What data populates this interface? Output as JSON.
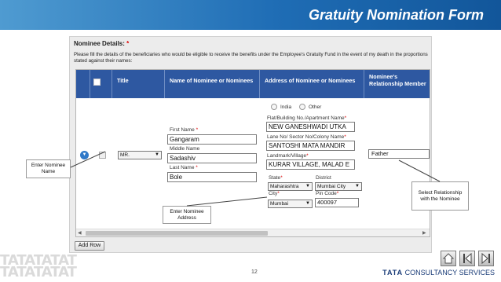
{
  "header": {
    "title": "Gratuity Nomination Form"
  },
  "form": {
    "section_title": "Nominee Details:",
    "required_mark": "*",
    "description": "Please fill the details of the beneficiaries who would be eligible to receive the benefits under the Employee's Gratuity Fund in the event of my death in the proportions stated against their names:"
  },
  "grid": {
    "columns": [
      "Title",
      "Name of Nominee or Nominees",
      "Address of Nominee or Nominees",
      "Nominee's Relationship Member"
    ],
    "row": {
      "title_value": "MR.",
      "first_name_label": "First Name",
      "first_name": "Gangaram",
      "middle_name_label": "Middle Name",
      "middle_name": "Sadashiv",
      "last_name_label": "Last Name",
      "last_name": "Bole",
      "address_options": [
        "India",
        "Other"
      ],
      "flat_label": "Flat/Building No./Apartment Name",
      "flat": "NEW GANESHWADI UTKA",
      "lane_label": "Lane No/ Sector No/Colony Name",
      "lane": "SANTOSHI MATA MANDIR",
      "landmark_label": "Landmark/Village",
      "landmark": "KURAR VILLAGE, MALAD E",
      "state_label": "State",
      "state": "Maharashtra",
      "district_label": "District",
      "district": "Mumbai City",
      "city_label": "City",
      "city": "Mumbai",
      "pin_label": "Pin Code",
      "pin": "400097",
      "relationship": "Father"
    }
  },
  "add_row_label": "Add Row",
  "callouts": {
    "name": "Enter Nominee Name",
    "address": "Enter Nominee Address",
    "relationship": "Select Relationship with the Nominee"
  },
  "footer": {
    "logo_left": "TATATATAT TATATATAT",
    "page_number": "12",
    "brand_bold": "TATA",
    "brand_rest": "CONSULTANCY SERVICES"
  },
  "icons": {
    "expand": "expand-circle-icon",
    "home": "home-icon",
    "previous": "previous-icon",
    "next": "next-icon"
  },
  "colors": {
    "header_blue": "#1f6db5",
    "grid_header": "#2e58a1",
    "required": "#dd0000"
  }
}
